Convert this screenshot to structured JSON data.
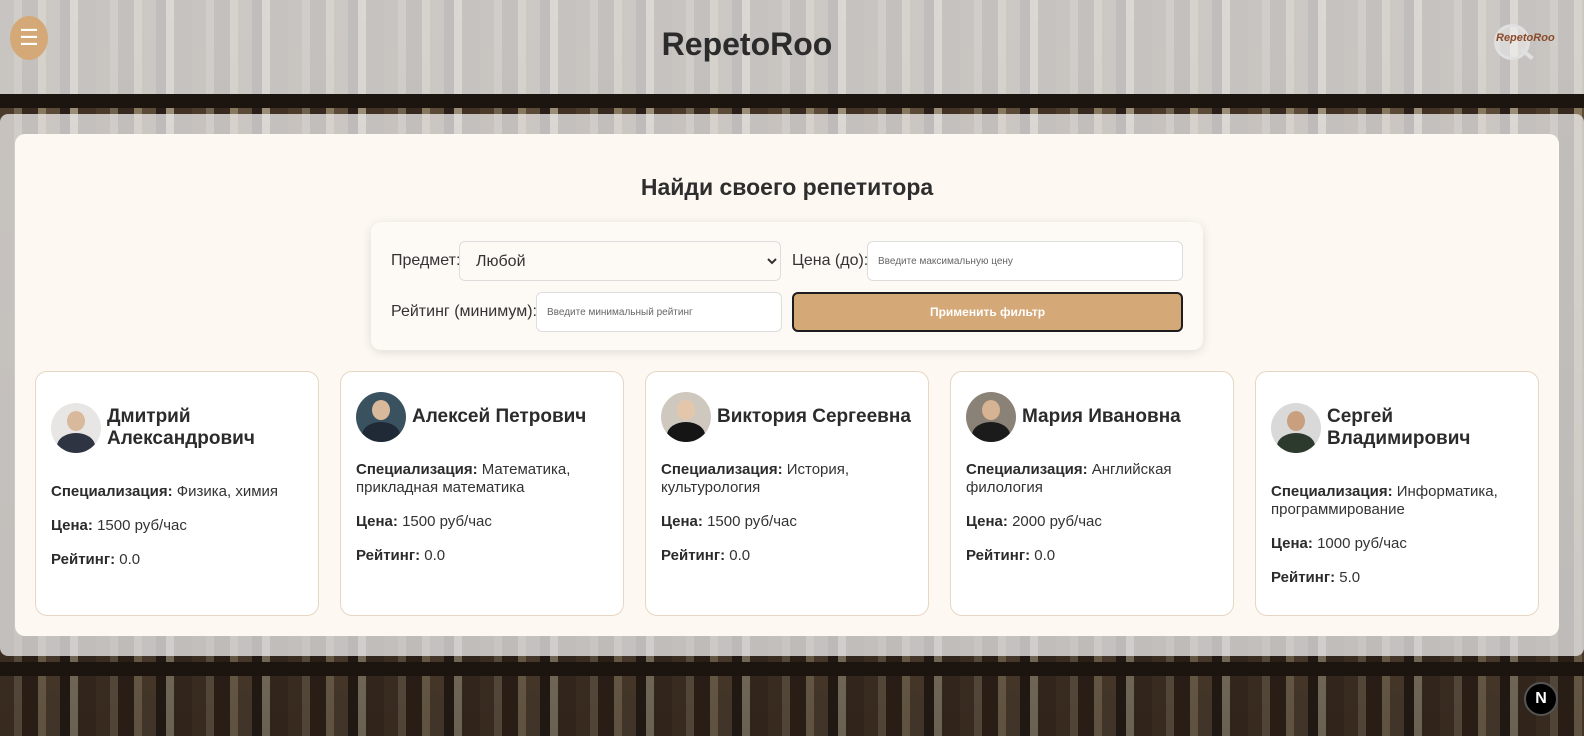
{
  "header": {
    "menu_icon": "☰",
    "title": "RepetoRoo",
    "logo_text": "RepetoRoo"
  },
  "main": {
    "heading": "Найди своего репетитора",
    "filters": {
      "subject_label": "Предмет:",
      "subject_selected": "Любой",
      "price_label": "Цена (до):",
      "price_placeholder": "Введите максимальную цену",
      "rating_label": "Рейтинг (минимум):",
      "rating_placeholder": "Введите минимальный рейтинг",
      "apply_label": "Применить фильтр"
    },
    "labels": {
      "spec": "Специализация:",
      "price": "Цена:",
      "rating": "Рейтинг:"
    },
    "tutors": [
      {
        "name": "Дмитрий Александрович",
        "spec": "Физика, химия",
        "price": "1500 руб/час",
        "rating": "0.0"
      },
      {
        "name": "Алексей Петрович",
        "spec": "Математика, прикладная математика",
        "price": "1500 руб/час",
        "rating": "0.0"
      },
      {
        "name": "Виктория Сергеевна",
        "spec": "История, культурология",
        "price": "1500 руб/час",
        "rating": "0.0"
      },
      {
        "name": "Мария Ивановна",
        "spec": "Английская филология",
        "price": "2000 руб/час",
        "rating": "0.0"
      },
      {
        "name": "Сергей Владимирович",
        "spec": "Информатика, программирование",
        "price": "1000 руб/час",
        "rating": "5.0"
      }
    ]
  },
  "badge": {
    "letter": "N"
  },
  "colors": {
    "accent": "#d4a877",
    "panel_bg": "#fdf8f2",
    "card_border": "#e6d6c4"
  }
}
